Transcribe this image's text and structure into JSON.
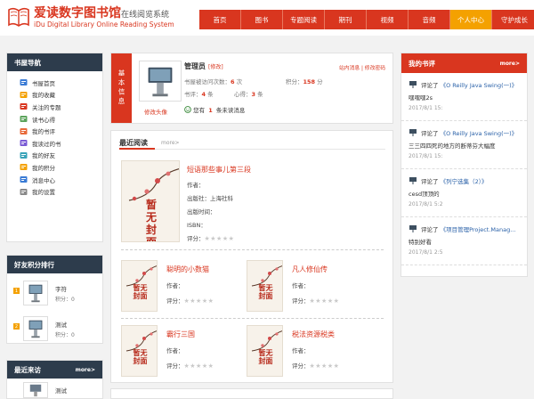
{
  "header": {
    "title": "爱读数字图书馆",
    "subtitle": "在线阅览系统",
    "title_en": "iDu Digital Library Online Reading System",
    "nav": [
      "首页",
      "图书",
      "专题阅读",
      "期刊",
      "视频",
      "音频",
      "个人中心",
      "守护成长"
    ],
    "active_index": 6
  },
  "sidebar": {
    "title": "书屋导航",
    "items": [
      "书屋首页",
      "我的收藏",
      "关注的专题",
      "读书心得",
      "我的书评",
      "我读过的书",
      "我的好友",
      "我的积分",
      "消息中心",
      "我的设置"
    ]
  },
  "friends": {
    "title": "好友积分排行",
    "list": [
      {
        "rank": "1",
        "name": "字符",
        "score_label": "积分：",
        "score": "0"
      },
      {
        "rank": "2",
        "name": "测试",
        "score_label": "积分：",
        "score": "0"
      }
    ]
  },
  "visitors": {
    "title": "最近来访",
    "more": "more>",
    "list": [
      {
        "name": "测试"
      }
    ]
  },
  "info": {
    "tag": "基本信息",
    "username": "管理员",
    "edit": "[修改]",
    "change_avatar": "修改头像",
    "links": "站内消息 | 修改密码",
    "visit_label": "书屋被访问次数：",
    "visit_count": "6",
    "visit_unit": "次",
    "points_label": "积分：",
    "points": "158",
    "points_unit": "分",
    "review_label": "书评：",
    "review_count": "4",
    "review_unit": "条",
    "notes_label": "心得：",
    "notes_count": "3",
    "notes_unit": "条",
    "msg_pre": "您有",
    "msg_count": "1",
    "msg_post": "条未读消息"
  },
  "recent": {
    "title": "最近阅读",
    "more": "more>",
    "no_cover": "暂无封面",
    "author_label": "作者：",
    "publisher_label": "出版社：",
    "time_label": "出版时间：",
    "isbn_label": "ISBN：",
    "rating_label": "评分：",
    "main_book": {
      "title": "短语那些事儿第三段",
      "publisher": "上海社科"
    },
    "books": [
      {
        "title": "聪明的小数猫"
      },
      {
        "title": "凡人修仙传"
      },
      {
        "title": "霸行三国"
      },
      {
        "title": "税法资源税类"
      }
    ]
  },
  "reviews": {
    "title": "我的书评",
    "more": "more>",
    "verb": "评论了",
    "list": [
      {
        "book": "《O Reilly Java Swing(一)》",
        "content": "嘿嘿嘿2s",
        "date": "2017/8/1 15:"
      },
      {
        "book": "《O Reilly Java Swing(一)》",
        "content": "三三四四死的地方的断蒂芬大幅度",
        "date": "2017/8/1 15:"
      },
      {
        "book": "《列宁选集（2）》",
        "content": "cesd顶顶的",
        "date": "2017/8/1 5:2"
      },
      {
        "book": "《项目管理Project.Manag...",
        "content": "特别好看",
        "date": "2017/8/1 2:5"
      }
    ]
  },
  "colors": {
    "brand": "#d9361f",
    "accent": "#f4a100",
    "dark": "#2d3c4c"
  }
}
